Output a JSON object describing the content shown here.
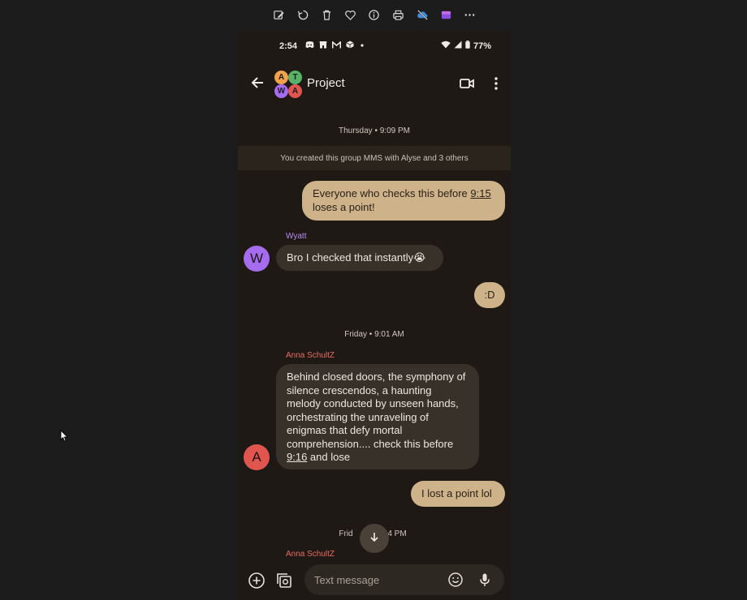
{
  "viewer_toolbar": {
    "icons": [
      "edit-icon",
      "rotate-icon",
      "delete-icon",
      "favorite-icon",
      "info-icon",
      "print-icon",
      "cloud-off-icon",
      "clipchamp-icon",
      "more-icon"
    ]
  },
  "status_bar": {
    "time": "2:54",
    "battery": "77%",
    "icons": [
      "discord-icon",
      "store-icon",
      "gmail-icon",
      "box-icon",
      "dot-icon",
      "wifi-icon",
      "signal-icon",
      "battery-icon"
    ]
  },
  "app_bar": {
    "title": "Project",
    "avatar_letters": [
      "A",
      "T",
      "W",
      "A"
    ]
  },
  "conversation": {
    "timestamps": [
      "Thursday • 9:09 PM",
      "Friday • 9:01 AM",
      "Frid",
      "4 PM"
    ],
    "system_message": "You created this group MMS with Alyse and 3 others",
    "messages": [
      {
        "from": "me",
        "text_before": "Everyone who checks this before ",
        "link": "9:15",
        "text_after": " loses a point!"
      },
      {
        "from": "Wyatt",
        "avatar": "W",
        "text": "Bro I checked that instantly😭"
      },
      {
        "from": "me",
        "text": ":D"
      },
      {
        "from": "Anna SchultZ",
        "avatar": "A",
        "text_before": "Behind closed doors, the symphony of silence crescendos, a haunting melody conducted by unseen hands, orchestrating the unraveling of enigmas that defy mortal comprehension.... check this before ",
        "link": "9:16",
        "text_after": " and lose"
      },
      {
        "from": "me",
        "text": "I lost a point lol"
      },
      {
        "from": "Anna SchultZ"
      }
    ]
  },
  "composer": {
    "placeholder": "Text message"
  },
  "colors": {
    "outgoing_bubble": "#cdb28a",
    "incoming_bubble": "#38312a",
    "background": "#1e1914",
    "wyatt": "#a56cf0",
    "anna": "#e0564f"
  }
}
